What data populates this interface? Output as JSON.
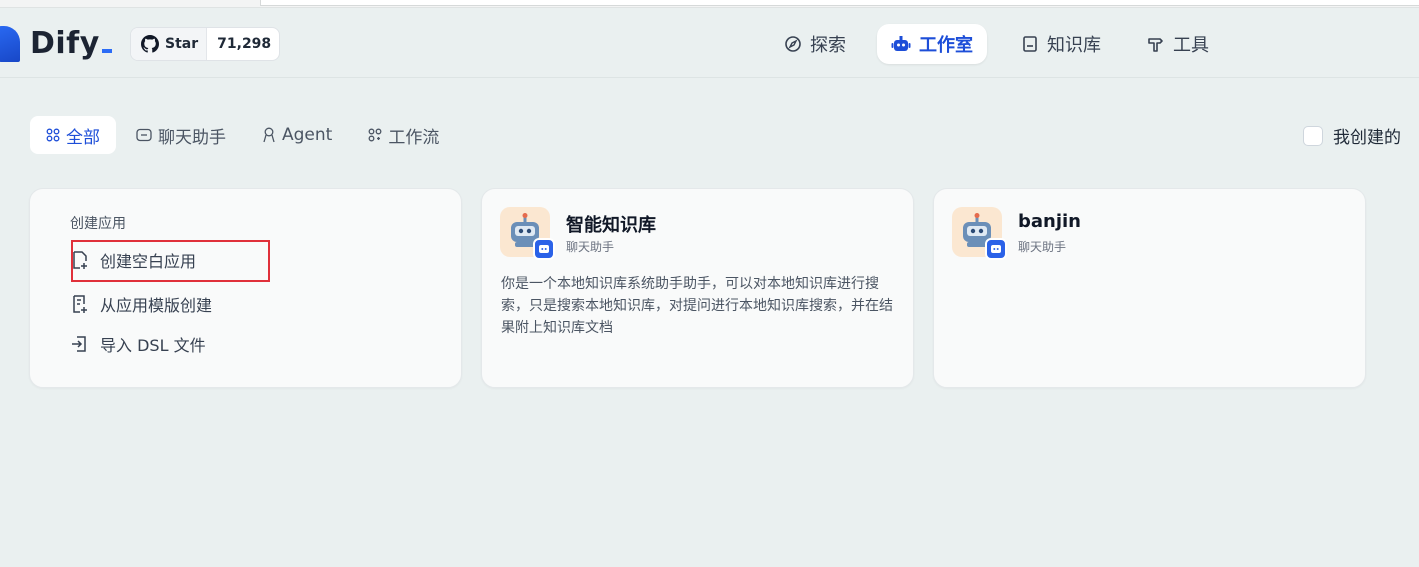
{
  "header": {
    "logo": "Dify",
    "github": {
      "star_label": "Star",
      "star_count": "71,298"
    },
    "nav": [
      {
        "label": "探索",
        "icon": "compass-icon",
        "active": false
      },
      {
        "label": "工作室",
        "icon": "robot-icon",
        "active": true
      },
      {
        "label": "知识库",
        "icon": "book-icon",
        "active": false
      },
      {
        "label": "工具",
        "icon": "hammer-icon",
        "active": false
      }
    ]
  },
  "filters": {
    "tabs": [
      {
        "label": "全部",
        "icon": "grid-icon",
        "active": true
      },
      {
        "label": "聊天助手",
        "icon": "chat-icon",
        "active": false
      },
      {
        "label": "Agent",
        "icon": "agent-icon",
        "active": false
      },
      {
        "label": "工作流",
        "icon": "workflow-icon",
        "active": false
      }
    ],
    "mine_label": "我创建的"
  },
  "create": {
    "title": "创建应用",
    "items": [
      {
        "label": "创建空白应用",
        "icon": "file-plus-icon"
      },
      {
        "label": "从应用模版创建",
        "icon": "template-icon"
      },
      {
        "label": "导入 DSL 文件",
        "icon": "import-icon"
      }
    ]
  },
  "apps": [
    {
      "name": "智能知识库",
      "type": "聊天助手",
      "description": "你是一个本地知识库系统助手助手，可以对本地知识库进行搜索，只是搜索本地知识库，对提问进行本地知识库搜索，并在结果附上知识库文档"
    },
    {
      "name": "banjin",
      "type": "聊天助手",
      "description": ""
    }
  ],
  "colors": {
    "accent": "#1d4ed8",
    "highlight_border": "#e0303a",
    "background": "#eaf0f0"
  }
}
